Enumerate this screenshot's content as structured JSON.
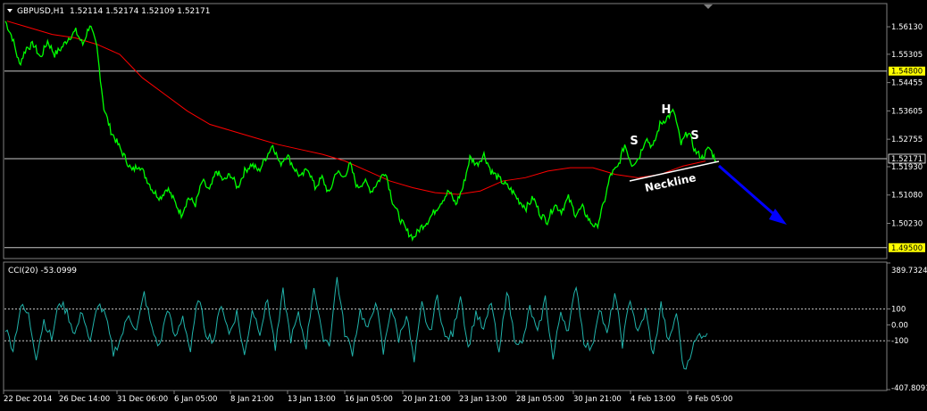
{
  "header": {
    "symbol": "GBPUSD,H1",
    "ohlc": "1.52114 1.52174 1.52109 1.52171",
    "cci_label": "CCI(20) -53.0999"
  },
  "colors": {
    "background": "#000000",
    "price": "#00FF00",
    "ma": "#FF0000",
    "cci": "#20B2AA",
    "arrow": "#0000FF",
    "text": "#FFFFFF",
    "yellow_label": "#FFFF00"
  },
  "chart_data": [
    {
      "type": "line",
      "name": "price-panel",
      "ylim": [
        1.492,
        1.568
      ],
      "y_ticks": [
        "1.56130",
        "1.55305",
        "1.54455",
        "1.53605",
        "1.52755",
        "1.51930",
        "1.51080",
        "1.50230"
      ],
      "hlines": [
        {
          "value": 1.548,
          "label": "1.54800"
        },
        {
          "value": 1.52171,
          "label": "1.52171"
        },
        {
          "value": 1.495,
          "label": "1.49500"
        }
      ],
      "annotations": [
        {
          "text": "S"
        },
        {
          "text": "H"
        },
        {
          "text": "S"
        },
        {
          "text": "Neckline"
        }
      ],
      "series": [
        {
          "values": [
            1.563,
            1.558,
            1.55,
            1.555,
            1.556,
            1.552,
            1.557,
            1.553,
            1.555,
            1.558,
            1.56,
            1.556,
            1.562,
            1.555,
            1.537,
            1.53,
            1.526,
            1.522,
            1.518,
            1.52,
            1.516,
            1.512,
            1.51,
            1.513,
            1.509,
            1.505,
            1.51,
            1.508,
            1.515,
            1.512,
            1.518,
            1.515,
            1.517,
            1.513,
            1.518,
            1.52,
            1.518,
            1.522,
            1.526,
            1.52,
            1.523,
            1.519,
            1.516,
            1.519,
            1.513,
            1.516,
            1.511,
            1.518,
            1.516,
            1.52,
            1.513,
            1.515,
            1.512,
            1.515,
            1.518,
            1.509,
            1.504,
            1.5,
            1.498,
            1.501,
            1.503,
            1.506,
            1.509,
            1.512,
            1.508,
            1.513,
            1.522,
            1.52,
            1.523,
            1.518,
            1.516,
            1.514,
            1.512,
            1.509,
            1.507,
            1.51,
            1.505,
            1.503,
            1.508,
            1.506,
            1.51,
            1.505,
            1.507,
            1.503,
            1.501,
            1.508,
            1.517,
            1.519,
            1.526,
            1.52,
            1.522,
            1.528,
            1.525,
            1.532,
            1.534,
            1.536,
            1.526,
            1.53,
            1.524,
            1.522,
            1.525,
            1.521
          ]
        },
        {
          "values": [
            1.563,
            1.561,
            1.559,
            1.558,
            1.556,
            1.553,
            1.546,
            1.541,
            1.536,
            1.532,
            1.53,
            1.528,
            1.526,
            1.5245,
            1.523,
            1.521,
            1.518,
            1.515,
            1.513,
            1.5115,
            1.511,
            1.512,
            1.515,
            1.516,
            1.518,
            1.519,
            1.519,
            1.517,
            1.516,
            1.517,
            1.5195,
            1.521
          ]
        }
      ]
    },
    {
      "type": "line",
      "name": "CCI(20)",
      "ylim": [
        -407.8091,
        389.7324
      ],
      "y_ticks": [
        "389.7324",
        "100",
        "0.00",
        "-100",
        "-407.8091"
      ],
      "levels": [
        100,
        -100
      ],
      "series": [
        {
          "name": "CCI(20)",
          "values": [
            -20,
            -150,
            120,
            60,
            -200,
            30,
            -90,
            150,
            80,
            -60,
            90,
            -120,
            140,
            50,
            -180,
            -80,
            70,
            -40,
            200,
            -30,
            -140,
            110,
            -90,
            60,
            -170,
            180,
            -50,
            -100,
            140,
            -60,
            80,
            -200,
            100,
            -40,
            160,
            -150,
            210,
            -90,
            60,
            -130,
            250,
            -60,
            -120,
            300,
            -50,
            -170,
            90,
            -40,
            160,
            -180,
            120,
            -90,
            70,
            -240,
            130,
            -60,
            180,
            -90,
            -60,
            200,
            -150,
            80,
            -40,
            150,
            -200,
            230,
            -80,
            -130,
            110,
            -60,
            170,
            -220,
            90,
            -40,
            260,
            -100,
            -160,
            120,
            -70,
            200,
            -120,
            170,
            -60,
            90,
            -200,
            130,
            -120,
            80,
            -300,
            -150,
            -60,
            -53.0999
          ]
        }
      ]
    }
  ],
  "x_axis": {
    "tick_labels": [
      "22 Dec 2014",
      "26 Dec 14:00",
      "31 Dec 06:00",
      "6 Jan 05:00",
      "8 Jan 21:00",
      "13 Jan 13:00",
      "16 Jan 05:00",
      "20 Jan 21:00",
      "23 Jan 13:00",
      "28 Jan 05:00",
      "30 Jan 21:00",
      "4 Feb 13:00",
      "9 Feb 05:00"
    ]
  }
}
